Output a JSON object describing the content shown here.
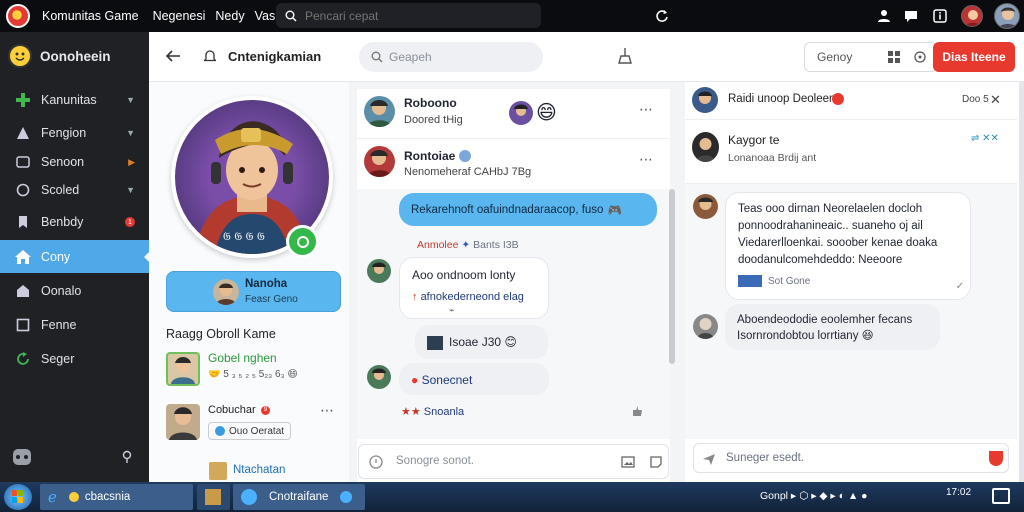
{
  "titlebar": {
    "app_name": "Komunitas Game",
    "menu": [
      "Negenesi",
      "Nedy",
      "Vas"
    ],
    "search_placeholder": "Pencari cepat"
  },
  "sidebar": {
    "brand": "Oonoheein",
    "items": [
      {
        "label": "Kanunitas",
        "icon": "plus-icon"
      },
      {
        "label": "Fengion",
        "icon": "bell-icon"
      },
      {
        "label": "Senoon",
        "icon": "alert-icon"
      },
      {
        "label": "Scoled",
        "icon": "circle-icon"
      },
      {
        "label": "Benbdy",
        "icon": "bookmark-icon",
        "badge": "1"
      },
      {
        "label": "Cony",
        "icon": "home-icon",
        "active": true
      },
      {
        "label": "Oonalo",
        "icon": "lock-icon"
      },
      {
        "label": "Fenne",
        "icon": "square-icon"
      },
      {
        "label": "Seger",
        "icon": "refresh-icon"
      }
    ]
  },
  "header": {
    "title": "Cntenigkamian",
    "search_placeholder": "Geapeh",
    "channel_label": "Genoy",
    "primary_button": "Dias Iteene"
  },
  "profile": {
    "name": "Nanoha",
    "subtitle": "Feasr Geno",
    "section_title": "Raagg Obroll Kame",
    "list": [
      {
        "title": "Gobel nghen",
        "meta": "5 ₃ ₅ ₂ ₅ 5₂₃ 6₃"
      },
      {
        "title": "Cobuchar",
        "meta": "Ouo Oeratat",
        "badge": "9"
      },
      {
        "title": "Ntachatan"
      }
    ]
  },
  "conversations": {
    "items": [
      {
        "name": "Roboono",
        "sub": "Doored tHig"
      },
      {
        "name": "Rontoiae",
        "sub": "Nenomeheraf CAHbJ 7Bg"
      }
    ]
  },
  "chat": {
    "pinned": "Rekarehnoft oafuindnadaraacop, fuso",
    "sender_label": "Anmolee",
    "sender_time": "Bants I3B",
    "msg1_line1": "Aoo ondnoom lonty",
    "msg1_line2": "afnokederneond elag",
    "msg2": "Isoae J30",
    "msg3": "Sonecnet",
    "reactions_label": "Snoanla",
    "reply_placeholder": "Sonogre sonot."
  },
  "detail": {
    "header_name": "Raidi unoop Deoleenn",
    "header_time": "Doo 5",
    "user_name": "Kaygor te",
    "user_sub": "Lonanoaa Brdij ant",
    "message_text": "Teas ooo dirnan Neorelaelen docloh ponnoodrahanineaic.. suaneho oj ail Viedarerlloenkai. sooober kenae doaka doodanulcomehdeddo: Neeoore",
    "message_meta": "Sot Gone",
    "message2_text": "Aboendeododie eoolemher fecans Isornrondobtou lorrtiany",
    "reply_placeholder": "Suneger esedt."
  },
  "taskbar": {
    "tasks": [
      "cbacsnia",
      "Cnotraifane"
    ],
    "clock": "17:02"
  },
  "colors": {
    "accent": "#4fa8e8",
    "danger": "#e8392f",
    "sidebar": "#1f2124"
  }
}
